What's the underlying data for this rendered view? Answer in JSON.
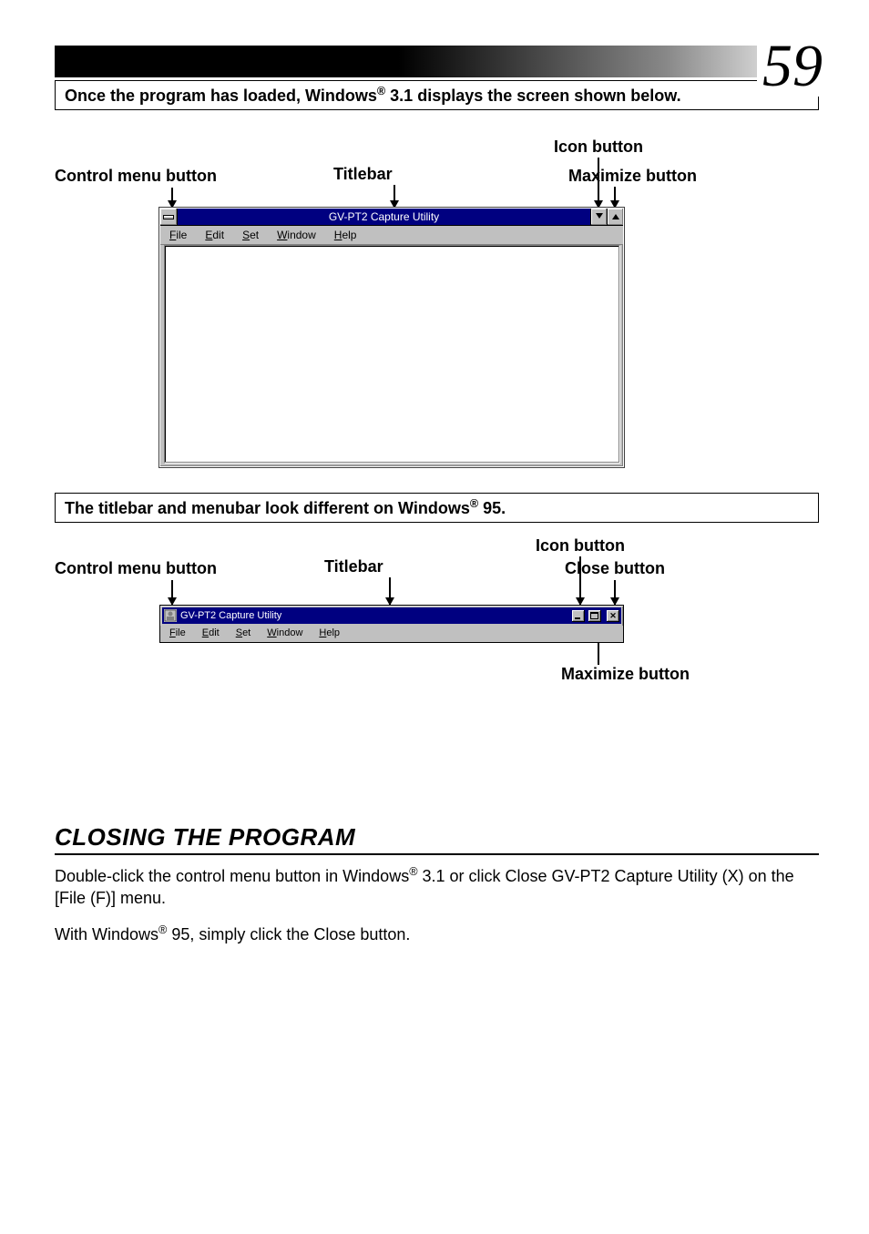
{
  "page_number": "59",
  "box1": {
    "prefix": "Once the program has loaded, Windows",
    "reg": "®",
    "suffix": " 3.1 displays the screen shown below."
  },
  "diagram1": {
    "labels": {
      "control_menu": "Control menu button",
      "titlebar": "Titlebar",
      "icon_button": "Icon button",
      "maximize": "Maximize button"
    },
    "window_title": "GV-PT2 Capture Utility",
    "menus": {
      "file": {
        "u": "F",
        "rest": "ile"
      },
      "edit": {
        "u": "E",
        "rest": "dit"
      },
      "set": {
        "u": "S",
        "rest": "et"
      },
      "window": {
        "u": "W",
        "rest": "indow"
      },
      "help": {
        "u": "H",
        "rest": "elp"
      }
    }
  },
  "box2": {
    "prefix": "The titlebar and menubar look different on Windows",
    "reg": "®",
    "suffix": " 95."
  },
  "diagram2": {
    "labels": {
      "control_menu": "Control menu button",
      "titlebar": "Titlebar",
      "icon_button": "Icon button",
      "close": "Close button",
      "maximize": "Maximize button"
    },
    "window_title": "GV-PT2 Capture Utility",
    "menus": {
      "file": {
        "u": "F",
        "rest": "ile"
      },
      "edit": {
        "u": "E",
        "rest": "dit"
      },
      "set": {
        "u": "S",
        "rest": "et"
      },
      "window": {
        "u": "W",
        "rest": "indow"
      },
      "help": {
        "u": "H",
        "rest": "elp"
      }
    }
  },
  "closing": {
    "heading": "CLOSING THE PROGRAM",
    "p1a": "Double-click the control menu button in Windows",
    "p1reg": "®",
    "p1b": " 3.1 or click Close GV-PT2 Capture Utility (X) on the [File (F)] menu.",
    "p2a": "With Windows",
    "p2reg": "®",
    "p2b": " 95, simply click the Close button."
  }
}
